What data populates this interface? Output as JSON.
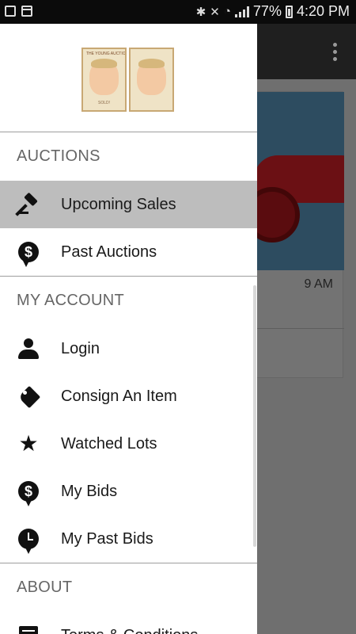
{
  "status_bar": {
    "battery": "77%",
    "time": "4:20 PM"
  },
  "background": {
    "lot_time": "9 AM"
  },
  "drawer": {
    "logo_alt": "The Young Auctioneers",
    "logo_cards": [
      {
        "caption": "THE YOUNG AUCTIONEERS",
        "footer": "SOLD!"
      },
      {
        "caption": "",
        "footer": ""
      }
    ],
    "sections": [
      {
        "title": "AUCTIONS",
        "items": [
          {
            "label": "Upcoming Sales",
            "icon": "gavel-icon",
            "active": true
          },
          {
            "label": "Past Auctions",
            "icon": "dollar-speech-icon",
            "active": false
          }
        ]
      },
      {
        "title": "MY ACCOUNT",
        "items": [
          {
            "label": "Login",
            "icon": "person-icon"
          },
          {
            "label": "Consign An Item",
            "icon": "tag-icon"
          },
          {
            "label": "Watched Lots",
            "icon": "star-icon"
          },
          {
            "label": "My Bids",
            "icon": "dollar-pin-icon"
          },
          {
            "label": "My Past Bids",
            "icon": "clock-pin-icon"
          }
        ]
      },
      {
        "title": "ABOUT",
        "items": [
          {
            "label": "Terms & Conditions",
            "icon": "document-icon"
          }
        ]
      }
    ]
  },
  "colors": {
    "drawer_bg": "#ffffff",
    "active_item_bg": "#bdbdbd",
    "section_text": "#666666",
    "item_text": "#1a1a1a",
    "scrim": "#6f6f6f"
  }
}
